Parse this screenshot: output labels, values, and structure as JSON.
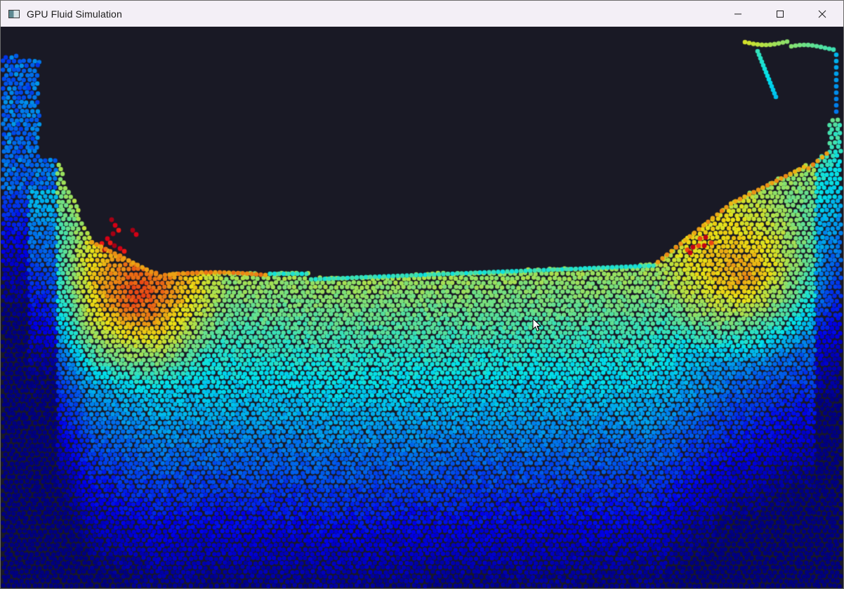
{
  "window": {
    "title": "GPU Fluid Simulation",
    "controls": {
      "minimize_icon": "minimize-icon",
      "maximize_icon": "maximize-icon",
      "close_icon": "close-icon"
    }
  },
  "simulation": {
    "background_color": "#191925",
    "colormap": "jet",
    "colors": {
      "slow": "#1d3fc4",
      "mid": "#2bd24a",
      "fast": "#f01a10"
    }
  }
}
